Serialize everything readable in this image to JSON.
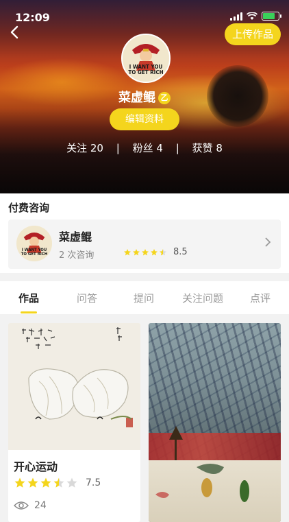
{
  "status": {
    "time": "12:09"
  },
  "header": {
    "upload_label": "上传作品",
    "avatar_text": "I WANT YOU\nTO GET RICH",
    "username": "菜虚鲲",
    "level_badge": "乙",
    "edit_label": "编辑资料",
    "stats": {
      "following_label": "关注",
      "following": "20",
      "fans_label": "粉丝",
      "fans": "4",
      "likes_label": "获赞",
      "likes": "8",
      "separator": "|"
    }
  },
  "consult": {
    "title": "付费咨询",
    "name": "菜虚鲲",
    "count_text": "2 次咨询",
    "rating": 4.5,
    "score": "8.5"
  },
  "tabs": [
    {
      "label": "作品",
      "active": true
    },
    {
      "label": "问答"
    },
    {
      "label": "提问"
    },
    {
      "label": "关注问题"
    },
    {
      "label": "点评"
    }
  ],
  "works": [
    {
      "title": "开心运动",
      "rating": 3.5,
      "score": "7.5",
      "views": "24"
    }
  ],
  "colors": {
    "accent": "#f4d51d"
  },
  "icons": {
    "back": "chevron-left-icon",
    "arrow": "chevron-right-icon",
    "eye": "eye-icon",
    "star": "star-icon"
  }
}
